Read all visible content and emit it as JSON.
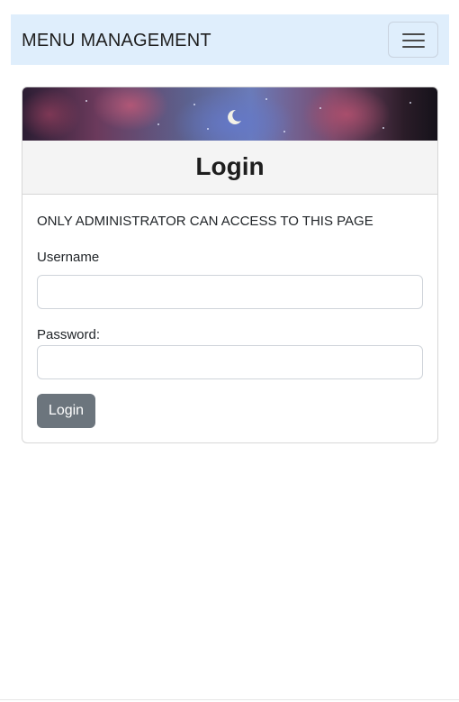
{
  "navbar": {
    "brand": "MENU MANAGEMENT",
    "toggler_icon": "hamburger-menu-icon",
    "background": "#dfeefc"
  },
  "login_card": {
    "banner_icon": "crescent-moon-icon",
    "title": "Login",
    "notice": "ONLY ADMINISTRATOR CAN ACCESS TO THIS PAGE",
    "username_label": "Username",
    "username_value": "",
    "password_label": "Password:",
    "password_value": "",
    "submit_label": "Login",
    "submit_color": "#6c757d"
  }
}
